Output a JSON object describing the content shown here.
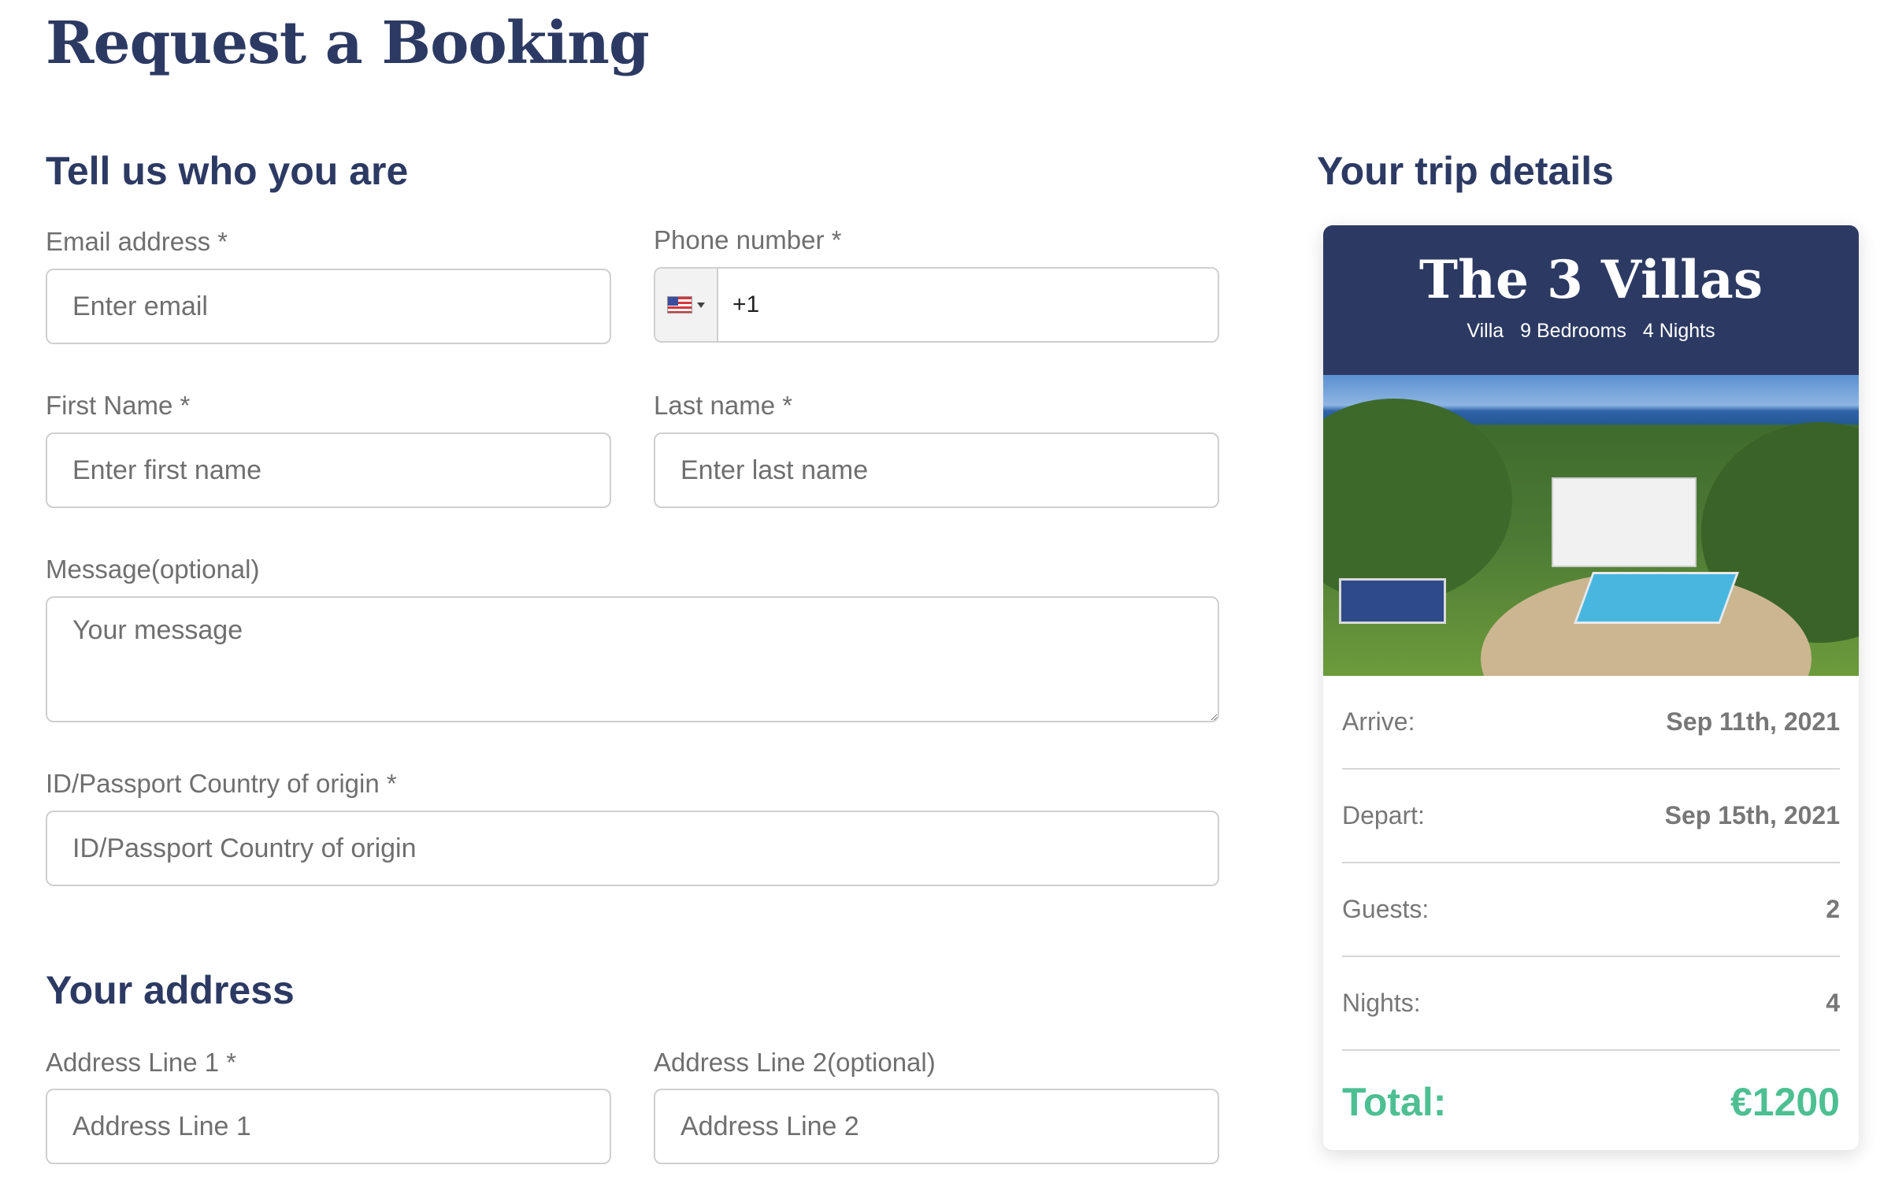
{
  "page": {
    "title": "Request a Booking"
  },
  "form": {
    "section_title": "Tell us who you are",
    "email": {
      "label": "Email address *",
      "placeholder": "Enter email"
    },
    "phone": {
      "label": "Phone number *",
      "value": "+1",
      "country_flag": "us-flag-icon"
    },
    "first_name": {
      "label": "First Name *",
      "placeholder": "Enter first name"
    },
    "last_name": {
      "label": "Last name *",
      "placeholder": "Enter last name"
    },
    "message": {
      "label": "Message(optional)",
      "placeholder": "Your message"
    },
    "passport_country": {
      "label": "ID/Passport Country of origin *",
      "placeholder": "ID/Passport Country of origin"
    }
  },
  "address": {
    "section_title": "Your address",
    "line1": {
      "label": "Address Line 1 *",
      "placeholder": "Address Line 1"
    },
    "line2": {
      "label": "Address Line 2(optional)",
      "placeholder": "Address Line 2"
    }
  },
  "trip": {
    "section_title": "Your trip details",
    "villa_name": "The 3 Villas",
    "type": "Villa",
    "bedrooms": "9 Bedrooms",
    "nights_summary": "4 Nights",
    "rows": [
      {
        "label": "Arrive:",
        "value": "Sep 11th, 2021"
      },
      {
        "label": "Depart:",
        "value": "Sep 15th, 2021"
      },
      {
        "label": "Guests:",
        "value": "2"
      },
      {
        "label": "Nights:",
        "value": "4"
      }
    ],
    "total_label": "Total:",
    "total_value": "€1200"
  },
  "colors": {
    "primary": "#2c3a63",
    "accent": "#4dbf93",
    "label": "#6f6f6f",
    "border": "#cfcfcf"
  }
}
